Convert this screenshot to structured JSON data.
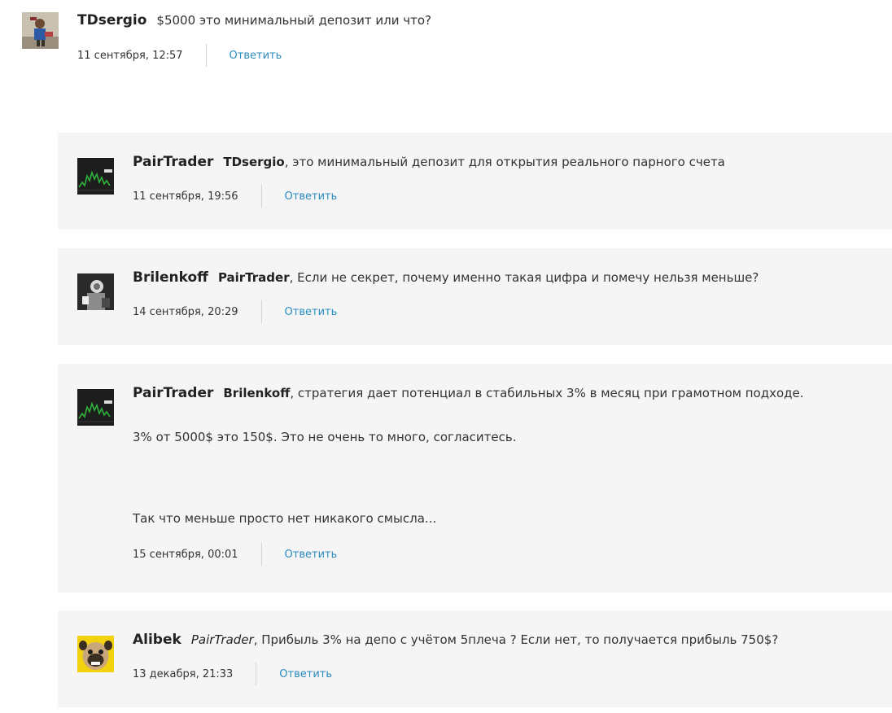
{
  "comments": [
    {
      "author": "TDsergio",
      "mention": "",
      "text": "$5000 это минимальный депозит или что?",
      "date": "11 сентября, 12:57",
      "reply_label": "Ответить",
      "avatar_icon": "user-avatar-photo"
    },
    {
      "author": "PairTrader",
      "mention": "TDsergio",
      "text": ", это минимальный депозит для открытия реального парного счета",
      "date": "11 сентября, 19:56",
      "reply_label": "Ответить",
      "avatar_icon": "chart-avatar"
    },
    {
      "author": "Brilenkoff",
      "mention": "PairTrader",
      "text": ", Если не секрет, почему именно такая цифра и помечу нельзя меньше?",
      "date": "14 сентября, 20:29",
      "reply_label": "Ответить",
      "avatar_icon": "bw-photo-avatar"
    },
    {
      "author": "PairTrader",
      "mention": "Brilenkoff",
      "text": ", стратегия дает потенциал в стабильных 3% в месяц при грамотном подходе.",
      "para2": "3% от 5000$ это 150$. Это не очень то много, согласитесь.",
      "para3": "Так что меньше просто нет никакого смысла...",
      "date": "15 сентября, 00:01",
      "reply_label": "Ответить",
      "avatar_icon": "chart-avatar"
    },
    {
      "author": "Alibek",
      "mention": "PairTrader",
      "text": ", Прибыль 3% на депо с учётом 5плеча ? Если нет, то получается прибыль 750$?",
      "date": "13 декабря, 21:33",
      "reply_label": "Ответить",
      "avatar_icon": "pug-avatar"
    }
  ]
}
